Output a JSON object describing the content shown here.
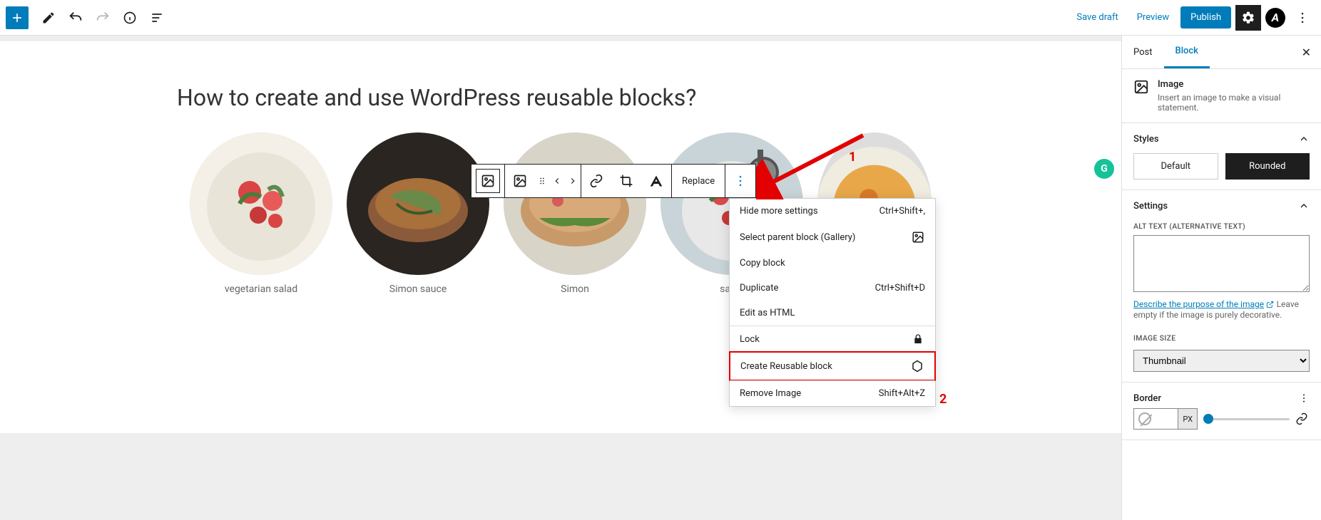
{
  "topbar": {
    "save_draft": "Save draft",
    "preview": "Preview",
    "publish": "Publish"
  },
  "post": {
    "title": "How to create and use WordPress reusable blocks?"
  },
  "toolbar": {
    "replace": "Replace"
  },
  "gallery": [
    {
      "caption": "vegetarian salad"
    },
    {
      "caption": "Simon sauce"
    },
    {
      "caption": "Simon"
    },
    {
      "caption": "salad"
    },
    {
      "caption": ""
    }
  ],
  "dropdown": {
    "hide_more": "Hide more settings",
    "hide_more_sc": "Ctrl+Shift+,",
    "select_parent": "Select parent block (Gallery)",
    "copy": "Copy block",
    "duplicate": "Duplicate",
    "duplicate_sc": "Ctrl+Shift+D",
    "edit_html": "Edit as HTML",
    "lock": "Lock",
    "create_reusable": "Create Reusable block",
    "remove": "Remove Image",
    "remove_sc": "Shift+Alt+Z"
  },
  "annotation": {
    "one": "1",
    "two": "2"
  },
  "sidebar": {
    "tab_post": "Post",
    "tab_block": "Block",
    "image_title": "Image",
    "image_desc": "Insert an image to make a visual statement.",
    "styles": "Styles",
    "style_default": "Default",
    "style_rounded": "Rounded",
    "settings": "Settings",
    "alt_label": "ALT TEXT (ALTERNATIVE TEXT)",
    "alt_link": "Describe the purpose of the image",
    "alt_hint": "Leave empty if the image is purely decorative.",
    "size_label": "IMAGE SIZE",
    "size_value": "Thumbnail",
    "border": "Border",
    "px": "PX"
  }
}
